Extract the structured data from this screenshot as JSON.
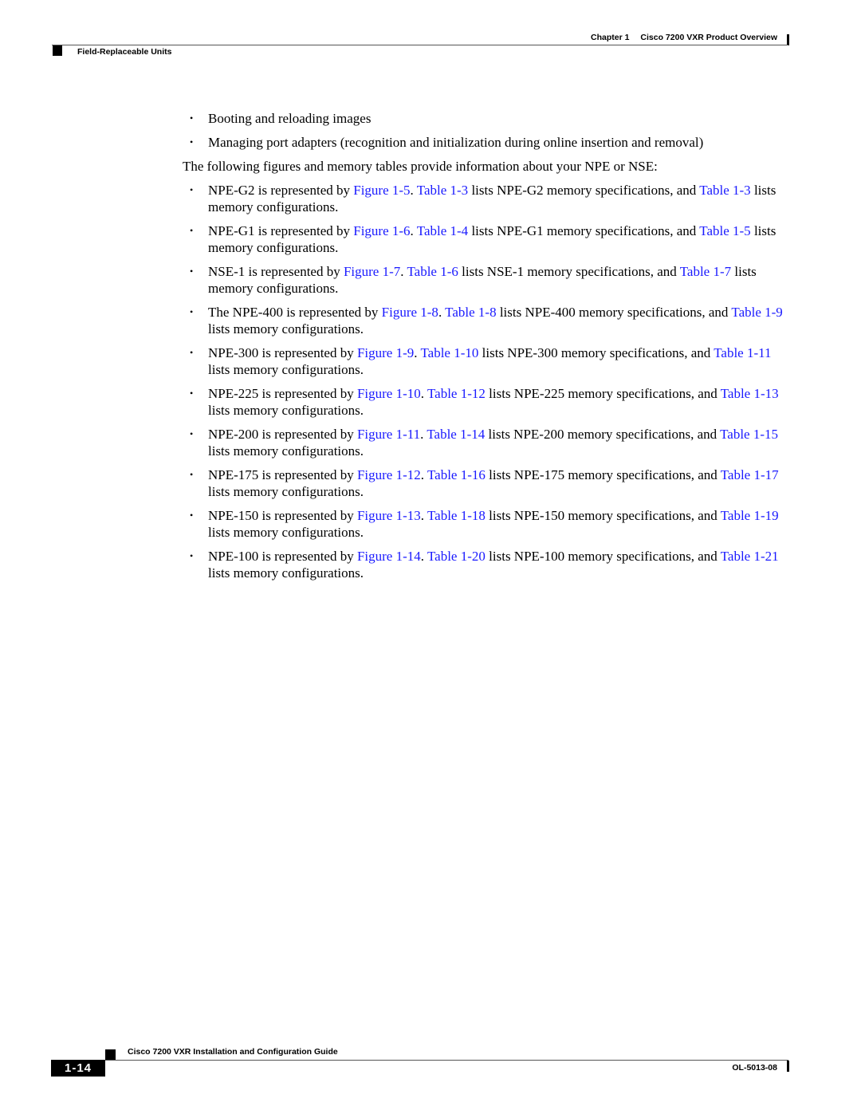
{
  "header": {
    "chapter_label": "Chapter 1",
    "chapter_title": "Cisco 7200 VXR Product Overview",
    "section_title": "Field-Replaceable Units"
  },
  "body": {
    "intro_bullets": [
      "Booting and reloading images",
      "Managing port adapters (recognition and initialization during online insertion and removal)"
    ],
    "lead_paragraph": "The following figures and memory tables provide information about your NPE or NSE:",
    "items": [
      {
        "prefix": "NPE-G2 is represented by ",
        "figure": "Figure 1-5",
        "sep": ". ",
        "spec_table": "Table 1-3",
        "mid": " lists NPE-G2 memory specifications, and ",
        "config_table": "Table 1-3",
        "suffix": " lists memory configurations."
      },
      {
        "prefix": "NPE-G1 is represented by ",
        "figure": "Figure 1-6",
        "sep": ". ",
        "spec_table": "Table 1-4",
        "mid": " lists NPE-G1 memory specifications, and ",
        "config_table": "Table 1-5",
        "suffix": " lists memory configurations."
      },
      {
        "prefix": "NSE-1 is represented by ",
        "figure": "Figure 1-7",
        "sep": ". ",
        "spec_table": "Table 1-6",
        "mid": " lists NSE-1 memory specifications, and ",
        "config_table": "Table 1-7",
        "suffix": " lists memory configurations."
      },
      {
        "prefix": "The NPE-400 is represented by ",
        "figure": "Figure 1-8",
        "sep": ". ",
        "spec_table": "Table 1-8",
        "mid": " lists NPE-400 memory specifications, and ",
        "config_table": "Table 1-9",
        "suffix": " lists memory configurations."
      },
      {
        "prefix": "NPE-300 is represented by ",
        "figure": "Figure 1-9",
        "sep": ". ",
        "spec_table": "Table 1-10",
        "mid": " lists NPE-300 memory specifications, and ",
        "config_table": "Table 1-11",
        "suffix": " lists memory configurations."
      },
      {
        "prefix": "NPE-225 is represented by ",
        "figure": "Figure 1-10",
        "sep": ". ",
        "spec_table": "Table 1-12",
        "mid": " lists NPE-225 memory specifications, and ",
        "config_table": "Table 1-13",
        "suffix": " lists memory configurations."
      },
      {
        "prefix": "NPE-200 is represented by ",
        "figure": "Figure 1-11",
        "sep": ". ",
        "spec_table": "Table 1-14",
        "mid": " lists NPE-200 memory specifications, and ",
        "config_table": "Table 1-15",
        "suffix": " lists memory configurations."
      },
      {
        "prefix": "NPE-175 is represented by ",
        "figure": "Figure 1-12",
        "sep": ". ",
        "spec_table": "Table 1-16",
        "mid": " lists NPE-175 memory specifications, and ",
        "config_table": "Table 1-17",
        "suffix": " lists memory configurations."
      },
      {
        "prefix": "NPE-150 is represented by ",
        "figure": "Figure 1-13",
        "sep": ". ",
        "spec_table": "Table 1-18",
        "mid": " lists NPE-150 memory specifications, and ",
        "config_table": "Table 1-19",
        "suffix": " lists memory configurations."
      },
      {
        "prefix": "NPE-100 is represented by ",
        "figure": "Figure 1-14",
        "sep": ". ",
        "spec_table": "Table 1-20",
        "mid": " lists NPE-100 memory specifications, and ",
        "config_table": "Table 1-21",
        "suffix": " lists memory configurations."
      }
    ],
    "bullet_glyph": "•"
  },
  "footer": {
    "guide_title": "Cisco 7200 VXR Installation and Configuration Guide",
    "page_number": "1-14",
    "doc_number": "OL-5013-08"
  },
  "colors": {
    "link": "#1a1aff",
    "text": "#000000"
  }
}
